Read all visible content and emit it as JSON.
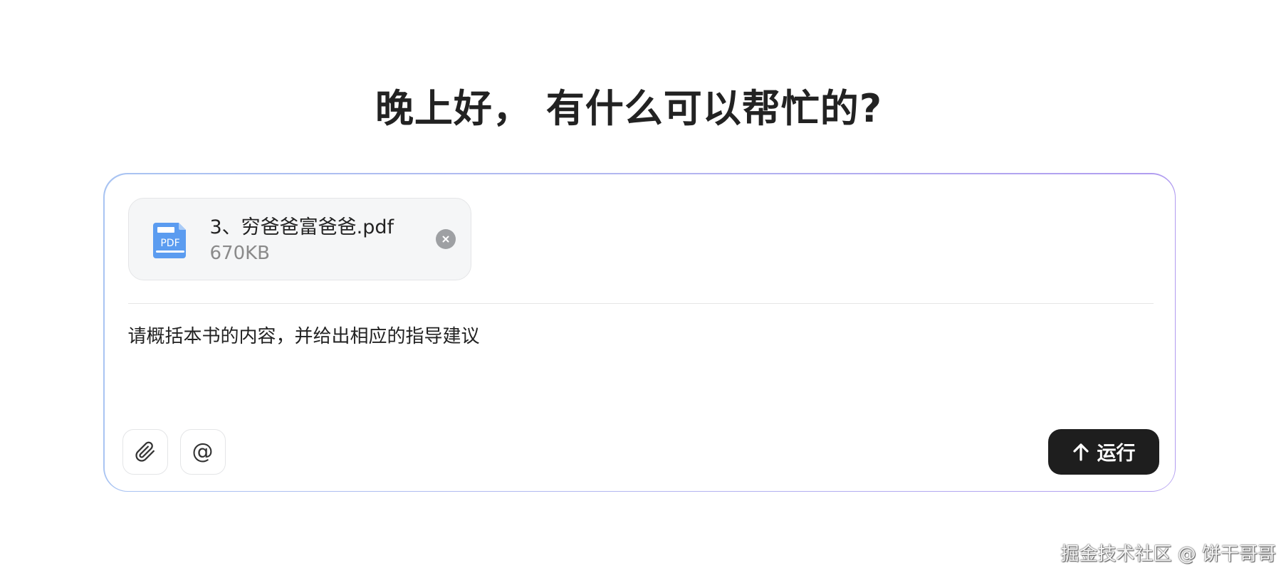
{
  "greeting": "晚上好， 有什么可以帮忙的?",
  "attachment": {
    "icon": "pdf-file-icon",
    "icon_label": "PDF",
    "file_name": "3、穷爸爸富爸爸.pdf",
    "file_size": "670KB",
    "remove_icon": "close-icon"
  },
  "input": {
    "value": "请概括本书的内容，并给出相应的指导建议",
    "placeholder": ""
  },
  "toolbar": {
    "attach_icon": "paperclip-icon",
    "mention_icon": "at-icon",
    "mention_glyph": "@",
    "run_icon": "arrow-up-icon",
    "run_label": "运行"
  },
  "watermark": "掘金技术社区 @ 饼干哥哥",
  "colors": {
    "accent_dark": "#1e1e1e",
    "border_gradient_start": "#a9c4f2",
    "border_gradient_end": "#b19cf0",
    "pdf_blue": "#5b9cf0"
  }
}
